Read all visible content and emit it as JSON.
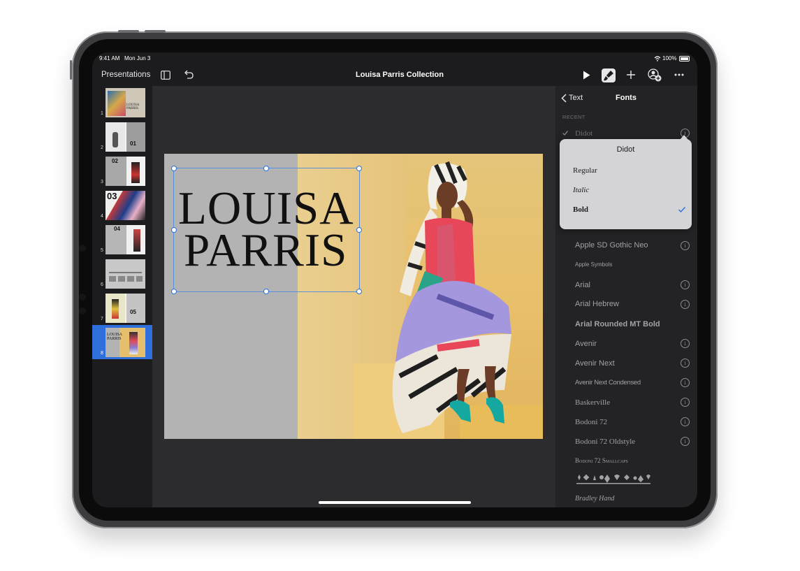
{
  "status": {
    "time": "9:41 AM",
    "date": "Mon Jun 3",
    "battery": "100%"
  },
  "toolbar": {
    "back_label": "Presentations",
    "title": "Louisa Parris Collection",
    "icons": [
      "sidebar-toggle-icon",
      "undo-icon",
      "play-icon",
      "format-brush-icon",
      "plus-icon",
      "collaborate-icon",
      "more-icon"
    ]
  },
  "navigator": {
    "slides": [
      {
        "number": "1",
        "thumb_text": "LOUISA PARRIS"
      },
      {
        "number": "2",
        "thumb_text": "01"
      },
      {
        "number": "3",
        "thumb_text": "02"
      },
      {
        "number": "4",
        "thumb_text": "03"
      },
      {
        "number": "5",
        "thumb_text": "04"
      },
      {
        "number": "6",
        "thumb_text": ""
      },
      {
        "number": "7",
        "thumb_text": "05"
      },
      {
        "number": "8",
        "thumb_text": "LOUISA PARRIS"
      }
    ],
    "selected": "8"
  },
  "slide": {
    "title_line1": "LOUISA",
    "title_line2": "PARRIS"
  },
  "sidebar": {
    "back_label": "Text",
    "title": "Fonts",
    "recent_header": "RECENT",
    "recent_font": "Didot",
    "popover": {
      "title": "Didot",
      "styles": [
        "Regular",
        "Italic",
        "Bold"
      ],
      "selected": "Bold"
    },
    "fonts": [
      "Apple SD Gothic Neo",
      "Apple Symbols",
      "Arial",
      "Arial Hebrew",
      "Arial Rounded MT Bold",
      "Avenir",
      "Avenir Next",
      "Avenir Next Condensed",
      "Baskerville",
      "Bodoni 72",
      "Bodoni 72 Oldstyle",
      "Bodoni 72 Smallcaps",
      "Bodoni Ornaments",
      "Bradley Hand"
    ]
  },
  "colors": {
    "accent": "#2a6fdc",
    "selection_blue": "#2f6fdb",
    "photo_bg": "#e8c06a"
  }
}
